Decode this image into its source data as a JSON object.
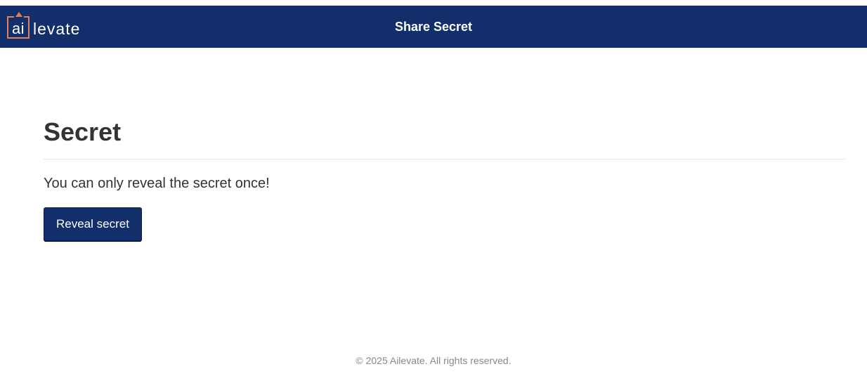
{
  "header": {
    "logo_ai": "ai",
    "logo_rest": "levate",
    "title": "Share Secret"
  },
  "main": {
    "heading": "Secret",
    "message": "You can only reveal the secret once!",
    "reveal_button_label": "Reveal secret"
  },
  "footer": {
    "copyright": "© 2025 Ailevate. All rights reserved."
  },
  "colors": {
    "navbar": "#122f6c",
    "logo_accent": "#e0805c"
  }
}
